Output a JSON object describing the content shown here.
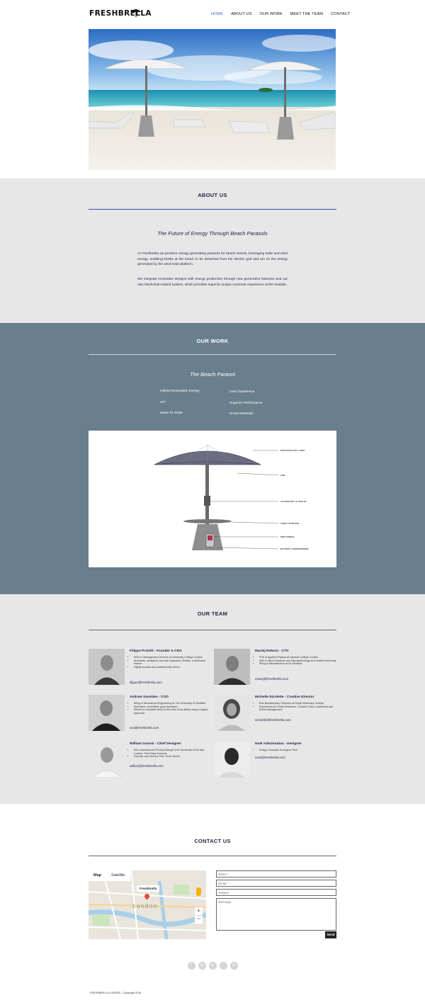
{
  "brand": "FRESHBRELLA",
  "nav": [
    "HOME",
    "ABOUT US",
    "OUR WORK",
    "MEET THE TEAM",
    "CONTACT"
  ],
  "about": {
    "title": "ABOUT US",
    "subtitle": "The Future of Energy Through Beach Parasols",
    "p1": "At Freshbrella we produce energy-generating parasols for beach resorts, leveraging solar and wind energy, enabling kiosks at the beach to be detached from the electric grid and run on the energy generated by the wind-solar platform.",
    "p2": "We integrate innovative designs with energy production through new generation batteries and our own blockchain-based system, which provides superior unique customer experience at the seaside."
  },
  "work": {
    "title": "OUR WORK",
    "subtitle": "The Beach Parasol",
    "features_left": [
      "Hybrid Renewable Energy",
      "IOT",
      "Made To Order"
    ],
    "features_right": [
      "User Experience",
      "Superior Performance",
      "Smart Materials"
    ],
    "diagram_labels": [
      "PHOTOVOLTAIC CANV",
      "FAN",
      "ACCESS KEY & TABLET",
      "TABLE SURFACE",
      "MINI FRIDGE",
      "BATTERY COMPARTMENT"
    ]
  },
  "team": {
    "title": "OUR TEAM",
    "members": [
      {
        "name": "Filippo Proietti - Founder & CEO",
        "bullets": [
          "MSci in Management Science at University College London",
          "Numerate, analytical, and well organized, flexible, a dedicated learner",
          "Highly focused and academically driven"
        ],
        "email": "filippo@freshbrella.com"
      },
      {
        "name": "Maciej Rokosz - CTO",
        "bullets": [
          "PhD in Applied Physics at Imperial College London",
          "MSc in Micro-Systems and Nanotechnology at Cranfield University",
          "BEng in Mechatronics at De Montfort"
        ],
        "email": "maciej@freshbrella.com"
      },
      {
        "name": "Andrew Savvides - COO",
        "bullets": [
          "BEng in Mechanical Engineering at The University of Sheffield",
          "Motivated, committed, goal orientated",
          "Strives to complete items to the best of his ability using a logical approach"
        ],
        "email": "sav@freshbrella.com"
      },
      {
        "name": "Michelle Nicolette - Creative Director",
        "bullets": [
          "BSc Bioveterinary Sciences at Royal Veterinary College",
          "Experienced in Public Relations, Creative Team Leadership and Brand Management"
        ],
        "email": "nicolette@freshbrella.com"
      },
      {
        "name": "William Govoni - Chief Designer",
        "bullets": [
          "BSc Industrial and Product Design from University of the Arts London, First Class Honours",
          "Founder and Director Plus Three Studio"
        ],
        "email": "william@freshbrella.com"
      },
      {
        "name": "Noël Adechoubou - Designer",
        "bullets": [
          "Design Graduate at Virginia Tech"
        ],
        "email": "noel@freshbrella.com"
      }
    ]
  },
  "contact": {
    "title": "CONTACT US",
    "map_tabs": [
      "Map",
      "Satellite"
    ],
    "map_pin_label": "Freshbrella",
    "map_city": "London",
    "name_placeholder": "Name *",
    "email_placeholder": "Email *",
    "subject_placeholder": "Subject",
    "message_placeholder": "Message",
    "send_label": "Send"
  },
  "socials": [
    "f",
    "ig",
    "in",
    "t",
    "yt"
  ],
  "footer": "FRESHBRELLA LIMITED - Copyright 2018"
}
